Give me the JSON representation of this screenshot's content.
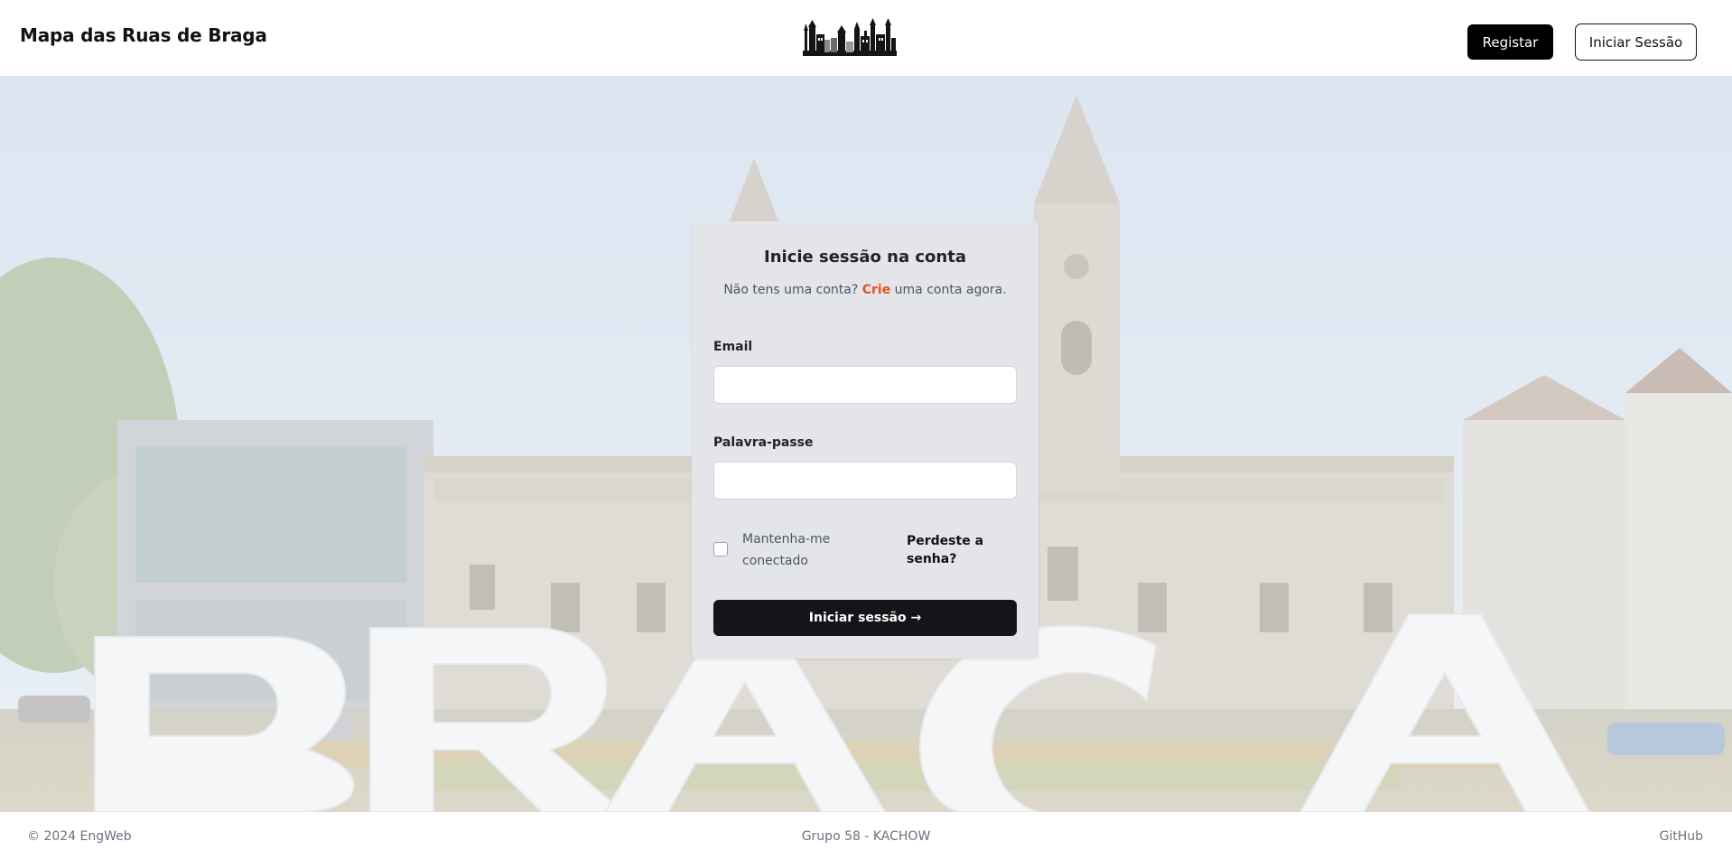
{
  "header": {
    "title": "Mapa das Ruas de Braga",
    "register_label": "Registar",
    "login_label": "Iniciar Sessão"
  },
  "hero": {
    "letters": "BRAGA"
  },
  "login_card": {
    "title": "Inicie sessão na conta",
    "subtitle_prefix": "Não tens uma conta? ",
    "subtitle_link": "Crie",
    "subtitle_suffix": " uma conta agora.",
    "email_label": "Email",
    "email_value": "",
    "password_label": "Palavra-passe",
    "password_value": "",
    "remember_label": "Mantenha-me conectado",
    "remember_checked": false,
    "forgot_label": "Perdeste a senha?",
    "submit_label": "Iniciar sessão →"
  },
  "footer": {
    "copyright": "© 2024 EngWeb",
    "group": "Grupo 58 - KACHOW",
    "github": "GitHub"
  },
  "colors": {
    "accent": "#e8501c",
    "primary_button": "#141518",
    "card_background": "#e4e5e9"
  }
}
